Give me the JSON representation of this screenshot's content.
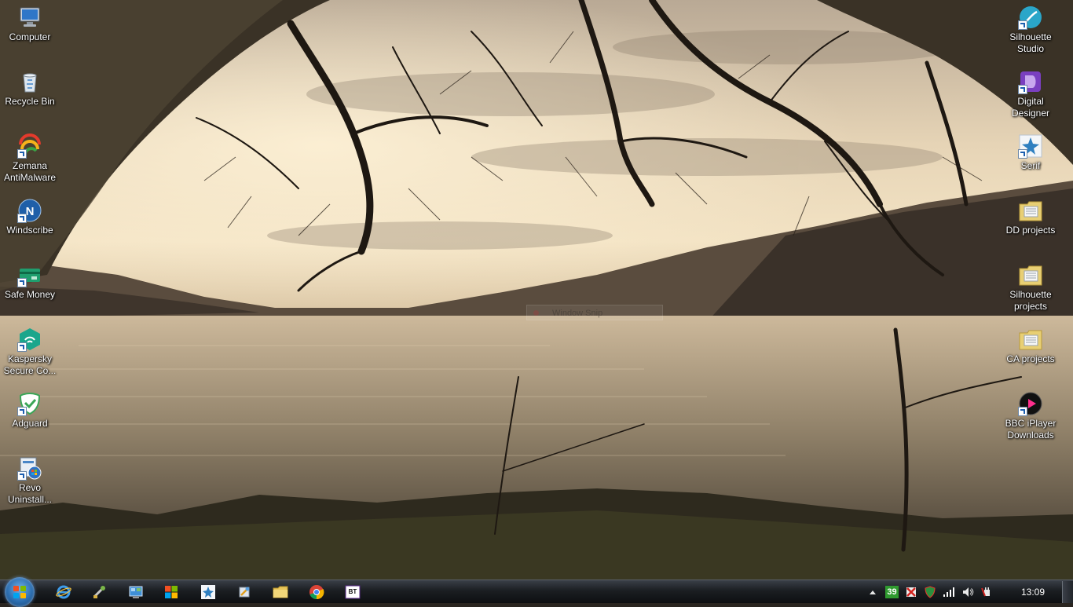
{
  "desktop": {
    "left_icons": [
      {
        "label": "Computer",
        "icon": "computer-icon"
      },
      {
        "label": "Recycle Bin",
        "icon": "recycle-bin-icon"
      },
      {
        "label": "Zemana\nAntiMalware",
        "icon": "zemana-icon"
      },
      {
        "label": "Windscribe",
        "icon": "windscribe-icon"
      },
      {
        "label": "Safe Money",
        "icon": "safe-money-icon"
      },
      {
        "label": "Kaspersky\nSecure Co...",
        "icon": "kaspersky-icon"
      },
      {
        "label": "Adguard",
        "icon": "adguard-icon"
      },
      {
        "label": "Revo\nUninstall...",
        "icon": "revo-uninstaller-icon"
      }
    ],
    "right_icons": [
      {
        "label": "Silhouette\nStudio",
        "icon": "silhouette-studio-icon"
      },
      {
        "label": "Digital\nDesigner",
        "icon": "digital-designer-icon"
      },
      {
        "label": "Serif",
        "icon": "serif-icon"
      },
      {
        "label": "DD projects",
        "icon": "folder-icon"
      },
      {
        "label": "Silhouette\nprojects",
        "icon": "folder-icon"
      },
      {
        "label": "CA projects",
        "icon": "folder-icon"
      },
      {
        "label": "BBC iPlayer\nDownloads",
        "icon": "bbc-iplayer-icon"
      }
    ],
    "ghost_window_title": "Window Snip"
  },
  "taskbar": {
    "pinned": [
      {
        "name": "internet-explorer-icon"
      },
      {
        "name": "tool-icon"
      },
      {
        "name": "control-panel-icon"
      },
      {
        "name": "windows-store-icon"
      },
      {
        "name": "serif-icon"
      },
      {
        "name": "utility-icon"
      },
      {
        "name": "file-explorer-icon"
      },
      {
        "name": "chrome-icon"
      },
      {
        "name": "bt-icon",
        "text": "BT"
      }
    ],
    "tray": {
      "badge_number": "39",
      "clock": "13:09"
    }
  },
  "colors": {
    "taskbar": "#1b1e22",
    "start_orb": "#2b6cae",
    "folder": "#e8cf74",
    "tray_badge": "#2f9a2f"
  }
}
